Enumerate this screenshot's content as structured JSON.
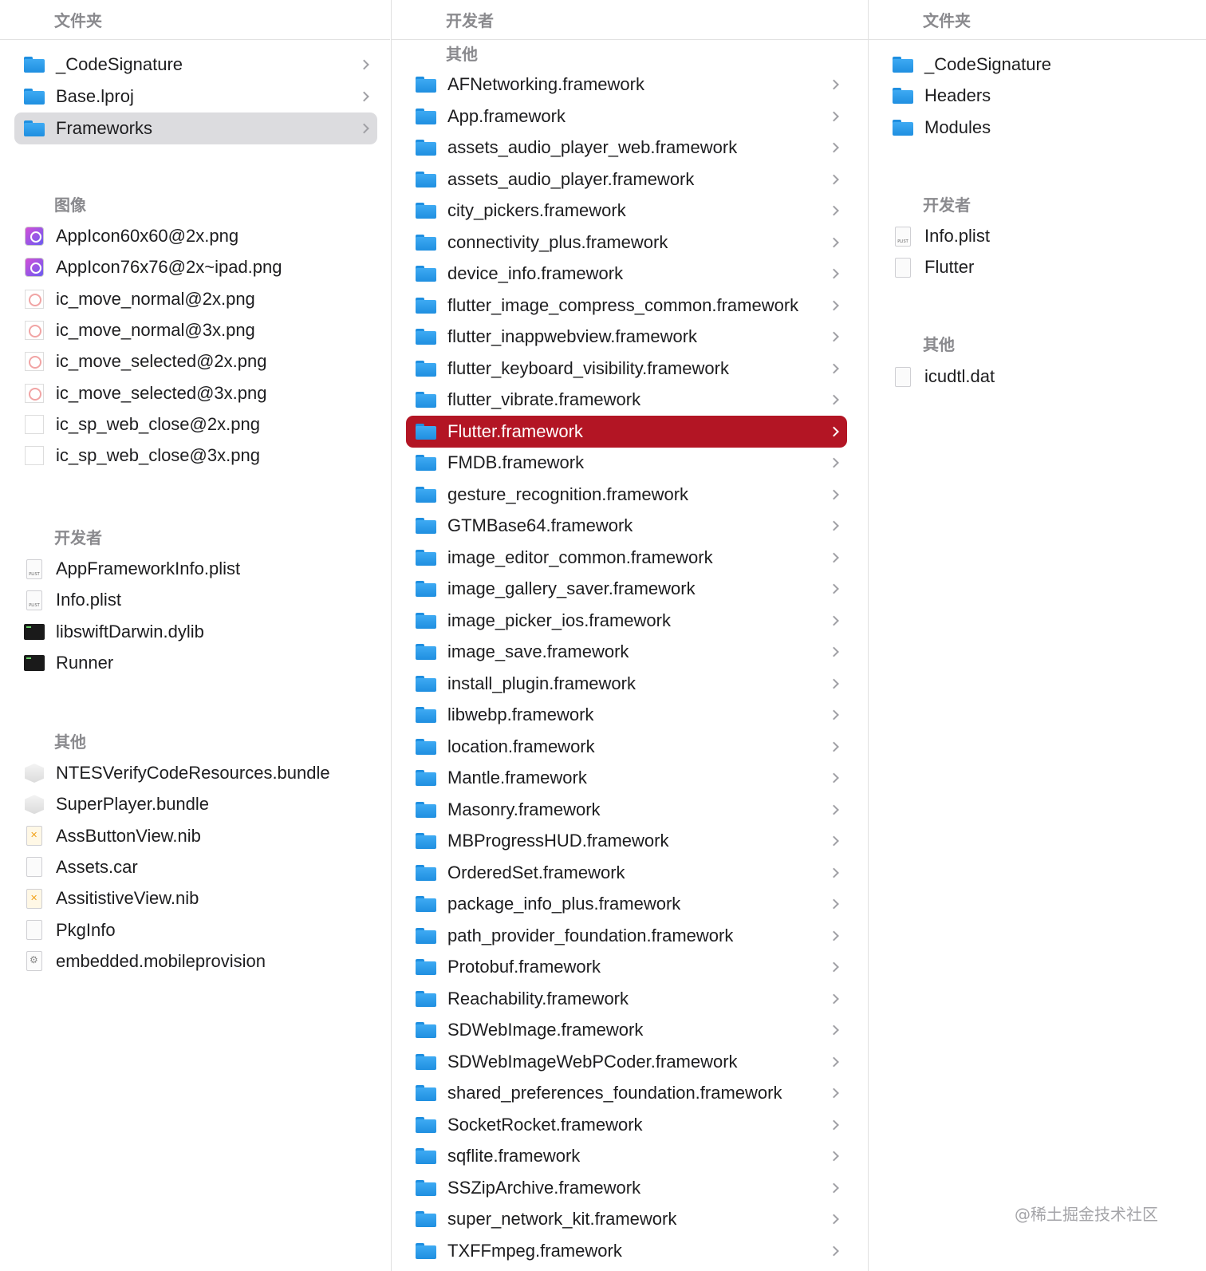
{
  "column1": {
    "header": "文件夹",
    "folders": [
      {
        "label": "_CodeSignature",
        "icon": "folder-icon"
      },
      {
        "label": "Base.lproj",
        "icon": "folder-icon"
      },
      {
        "label": "Frameworks",
        "icon": "folder-icon",
        "selected": true
      }
    ],
    "images_title": "图像",
    "images": [
      {
        "label": "AppIcon60x60@2x.png",
        "icon": "app-icon-image"
      },
      {
        "label": "AppIcon76x76@2x~ipad.png",
        "icon": "app-icon-image"
      },
      {
        "label": "ic_move_normal@2x.png",
        "icon": "ring-image-icon"
      },
      {
        "label": "ic_move_normal@3x.png",
        "icon": "ring-image-icon"
      },
      {
        "label": "ic_move_selected@2x.png",
        "icon": "ring-image-icon"
      },
      {
        "label": "ic_move_selected@3x.png",
        "icon": "ring-image-icon"
      },
      {
        "label": "ic_sp_web_close@2x.png",
        "icon": "blank-image-icon"
      },
      {
        "label": "ic_sp_web_close@3x.png",
        "icon": "blank-image-icon"
      }
    ],
    "developer_title": "开发者",
    "developer": [
      {
        "label": "AppFrameworkInfo.plist",
        "icon": "plist-file-icon"
      },
      {
        "label": "Info.plist",
        "icon": "plist-file-icon"
      },
      {
        "label": "libswiftDarwin.dylib",
        "icon": "executable-icon"
      },
      {
        "label": "Runner",
        "icon": "executable-icon"
      }
    ],
    "other_title": "其他",
    "other": [
      {
        "label": "NTESVerifyCodeResources.bundle",
        "icon": "bundle-icon"
      },
      {
        "label": "SuperPlayer.bundle",
        "icon": "bundle-icon"
      },
      {
        "label": "AssButtonView.nib",
        "icon": "nib-file-icon"
      },
      {
        "label": "Assets.car",
        "icon": "document-icon"
      },
      {
        "label": "AssitistiveView.nib",
        "icon": "nib-file-icon"
      },
      {
        "label": "PkgInfo",
        "icon": "document-icon"
      },
      {
        "label": "embedded.mobileprovision",
        "icon": "provision-file-icon"
      }
    ]
  },
  "column2": {
    "header": "开发者",
    "other_title": "其他",
    "items": [
      "AFNetworking.framework",
      "App.framework",
      "assets_audio_player_web.framework",
      "assets_audio_player.framework",
      "city_pickers.framework",
      "connectivity_plus.framework",
      "device_info.framework",
      "flutter_image_compress_common.framework",
      "flutter_inappwebview.framework",
      "flutter_keyboard_visibility.framework",
      "flutter_vibrate.framework",
      "Flutter.framework",
      "FMDB.framework",
      "gesture_recognition.framework",
      "GTMBase64.framework",
      "image_editor_common.framework",
      "image_gallery_saver.framework",
      "image_picker_ios.framework",
      "image_save.framework",
      "install_plugin.framework",
      "libwebp.framework",
      "location.framework",
      "Mantle.framework",
      "Masonry.framework",
      "MBProgressHUD.framework",
      "OrderedSet.framework",
      "package_info_plus.framework",
      "path_provider_foundation.framework",
      "Protobuf.framework",
      "Reachability.framework",
      "SDWebImage.framework",
      "SDWebImageWebPCoder.framework",
      "shared_preferences_foundation.framework",
      "SocketRocket.framework",
      "sqflite.framework",
      "SSZipArchive.framework",
      "super_network_kit.framework",
      "TXFFmpeg.framework"
    ],
    "selected_label": "Flutter.framework"
  },
  "column3": {
    "header": "文件夹",
    "folders": [
      "_CodeSignature",
      "Headers",
      "Modules"
    ],
    "developer_title": "开发者",
    "developer": [
      {
        "label": "Info.plist",
        "icon": "plist-file-icon"
      },
      {
        "label": "Flutter",
        "icon": "document-icon"
      }
    ],
    "other_title": "其他",
    "other": [
      {
        "label": "icudtl.dat",
        "icon": "document-icon"
      }
    ]
  },
  "watermark": "@稀土掘金技术社区",
  "colors": {
    "selection_red": "#b31524",
    "selection_gray": "#dcdcdf",
    "folder_blue": "#1f8fe0"
  }
}
